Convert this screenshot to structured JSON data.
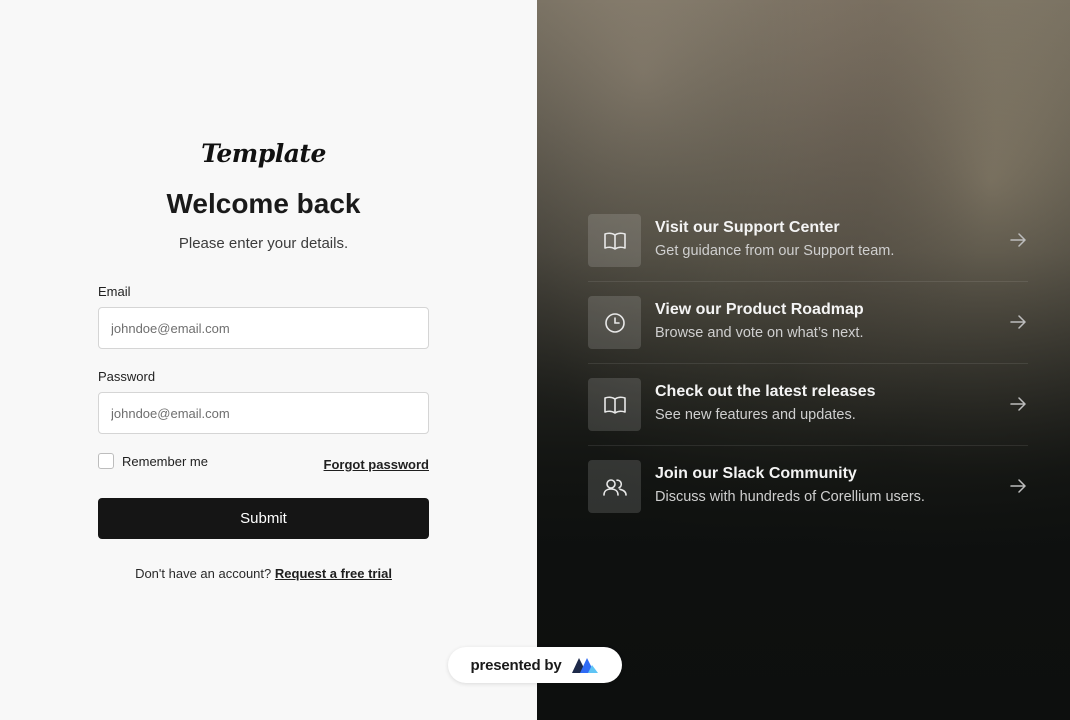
{
  "brand": {
    "logo_text": "Template"
  },
  "login": {
    "title": "Welcome back",
    "subtitle": "Please enter your details.",
    "email_label": "Email",
    "email_placeholder": "johndoe@email.com",
    "password_label": "Password",
    "password_placeholder": "johndoe@email.com",
    "remember_label": "Remember me",
    "remember_checked": false,
    "forgot_label": "Forgot password",
    "submit_label": "Submit",
    "signup_prompt": "Don't have an account?",
    "signup_link": "Request a free trial"
  },
  "resources": [
    {
      "icon": "book-icon",
      "title": "Visit our Support Center",
      "description": "Get guidance from our Support team."
    },
    {
      "icon": "clock-icon",
      "title": "View our Product Roadmap",
      "description": "Browse and vote on what’s next."
    },
    {
      "icon": "book-icon",
      "title": "Check out the latest releases",
      "description": "See new features and updates."
    },
    {
      "icon": "users-icon",
      "title": "Join our Slack Community",
      "description": "Discuss with hundreds of Corellium users."
    }
  ],
  "badge": {
    "text": "presented by",
    "icon": "brand-logo-icon"
  },
  "colors": {
    "primary_button": "#151515",
    "right_panel_dark": "#0e100f",
    "logo_blue": "#2f6bf5"
  }
}
